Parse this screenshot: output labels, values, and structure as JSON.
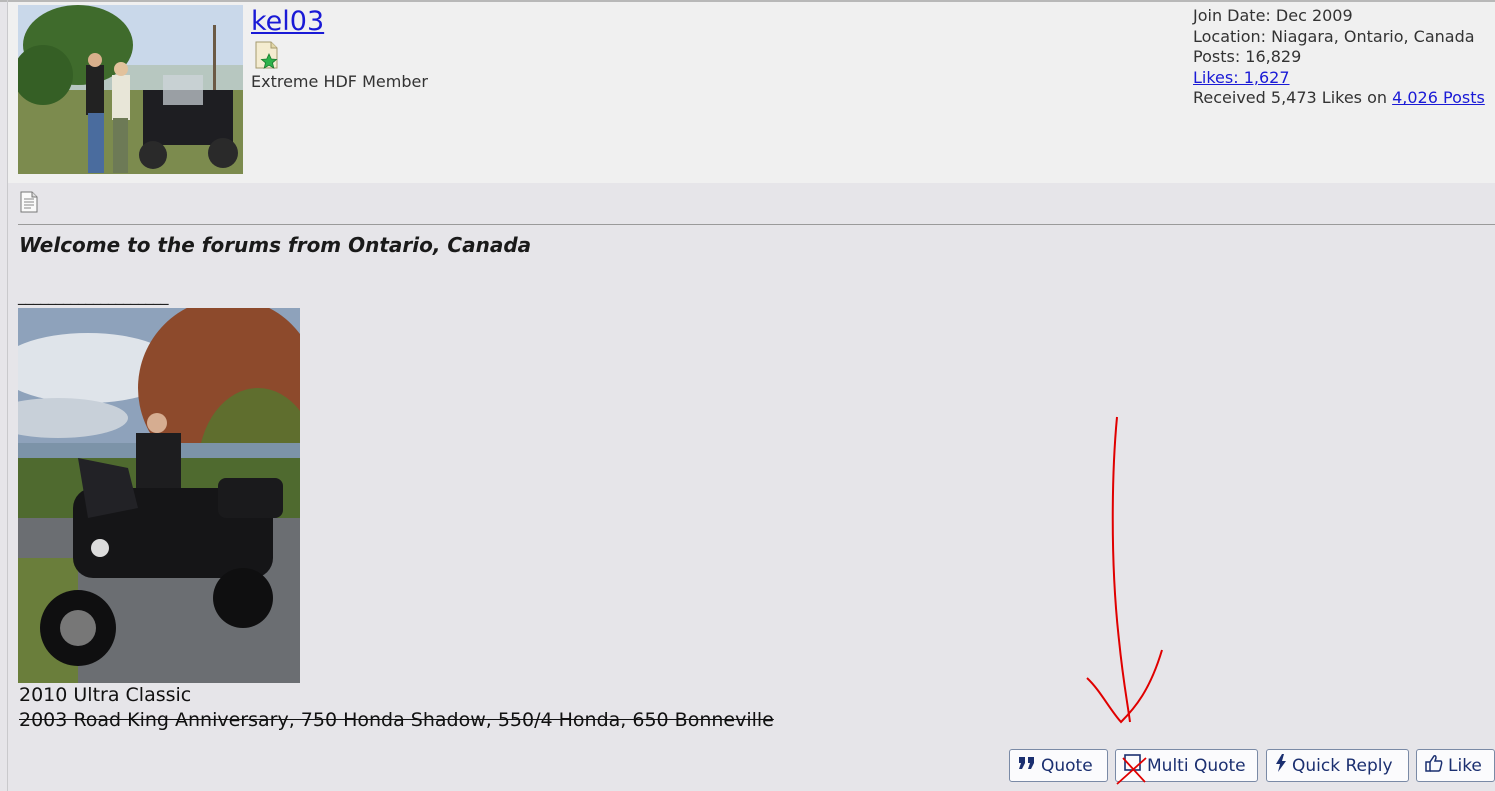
{
  "user": {
    "username": "kel03",
    "title": "Extreme HDF Member",
    "join_date": "Join Date: Dec 2009",
    "location": "Location: Niagara, Ontario, Canada",
    "posts": "Posts: 16,829",
    "likes": "Likes: 1,627",
    "received_prefix": "Received 5,473 Likes on ",
    "received_link": "4,026 Posts"
  },
  "post": {
    "message": "Welcome to the forums from Ontario, Canada"
  },
  "signature": {
    "line": "____________________",
    "current_bike": "2010 Ultra Classic",
    "former_bikes": "2003 Road King Anniversary, 750 Honda Shadow, 550/4 Honda, 650 Bonneville"
  },
  "buttons": {
    "quote": "Quote",
    "multi_quote": "Multi Quote",
    "quick_reply": "Quick Reply",
    "like": "Like"
  },
  "icons": {
    "post": "document-icon",
    "rank": "star-badge-icon",
    "quote": "quote-icon",
    "multi_quote": "checkbox-icon",
    "quick_reply": "lightning-icon",
    "like": "thumbs-up-icon"
  },
  "colors": {
    "link": "#1a1ad6",
    "button_text": "#1b2f70",
    "annotation": "#e00000"
  }
}
